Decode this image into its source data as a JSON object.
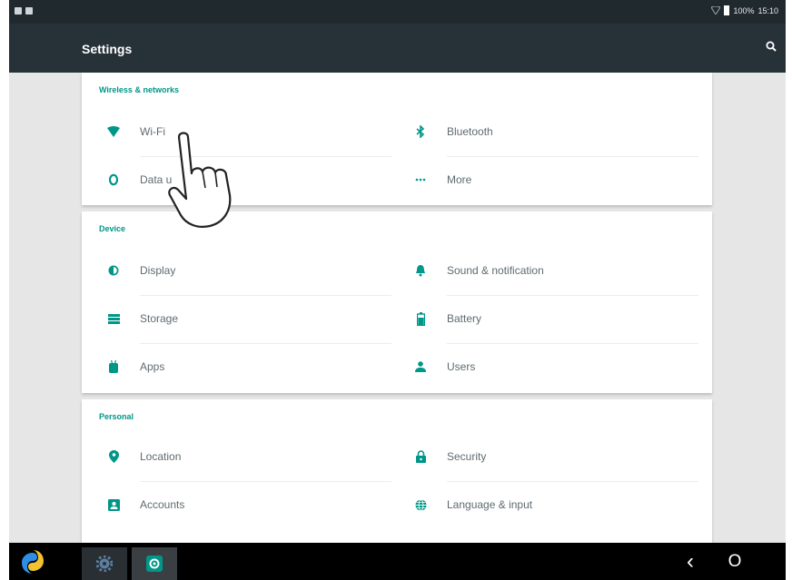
{
  "statusbar": {
    "battery": "100%",
    "time": "15:10"
  },
  "appbar": {
    "title": "Settings"
  },
  "sections": [
    {
      "title": "Wireless & networks",
      "items": [
        {
          "label": "Wi-Fi",
          "icon": "wifi-icon"
        },
        {
          "label": "Bluetooth",
          "icon": "bluetooth-icon"
        },
        {
          "label": "Data u",
          "icon": "data-usage-icon"
        },
        {
          "label": "More",
          "icon": "more-icon"
        }
      ]
    },
    {
      "title": "Device",
      "items": [
        {
          "label": "Display",
          "icon": "display-icon"
        },
        {
          "label": "Sound & notification",
          "icon": "bell-icon"
        },
        {
          "label": "Storage",
          "icon": "storage-icon"
        },
        {
          "label": "Battery",
          "icon": "battery-icon"
        },
        {
          "label": "Apps",
          "icon": "apps-icon"
        },
        {
          "label": "Users",
          "icon": "user-icon"
        }
      ]
    },
    {
      "title": "Personal",
      "items": [
        {
          "label": "Location",
          "icon": "location-pin-icon"
        },
        {
          "label": "Security",
          "icon": "lock-icon"
        },
        {
          "label": "Accounts",
          "icon": "accounts-icon"
        },
        {
          "label": "Language & input",
          "icon": "globe-icon"
        }
      ]
    }
  ],
  "navbar": {
    "back_glyph": "‹",
    "home_glyph": "O",
    "apps": [
      "launcher-logo-icon",
      "gear-app-icon",
      "settings-app-icon"
    ]
  },
  "colors": {
    "accent": "#009688",
    "appbar": "#263238",
    "statusbar": "#20292e",
    "background": "#e6e6e6"
  }
}
